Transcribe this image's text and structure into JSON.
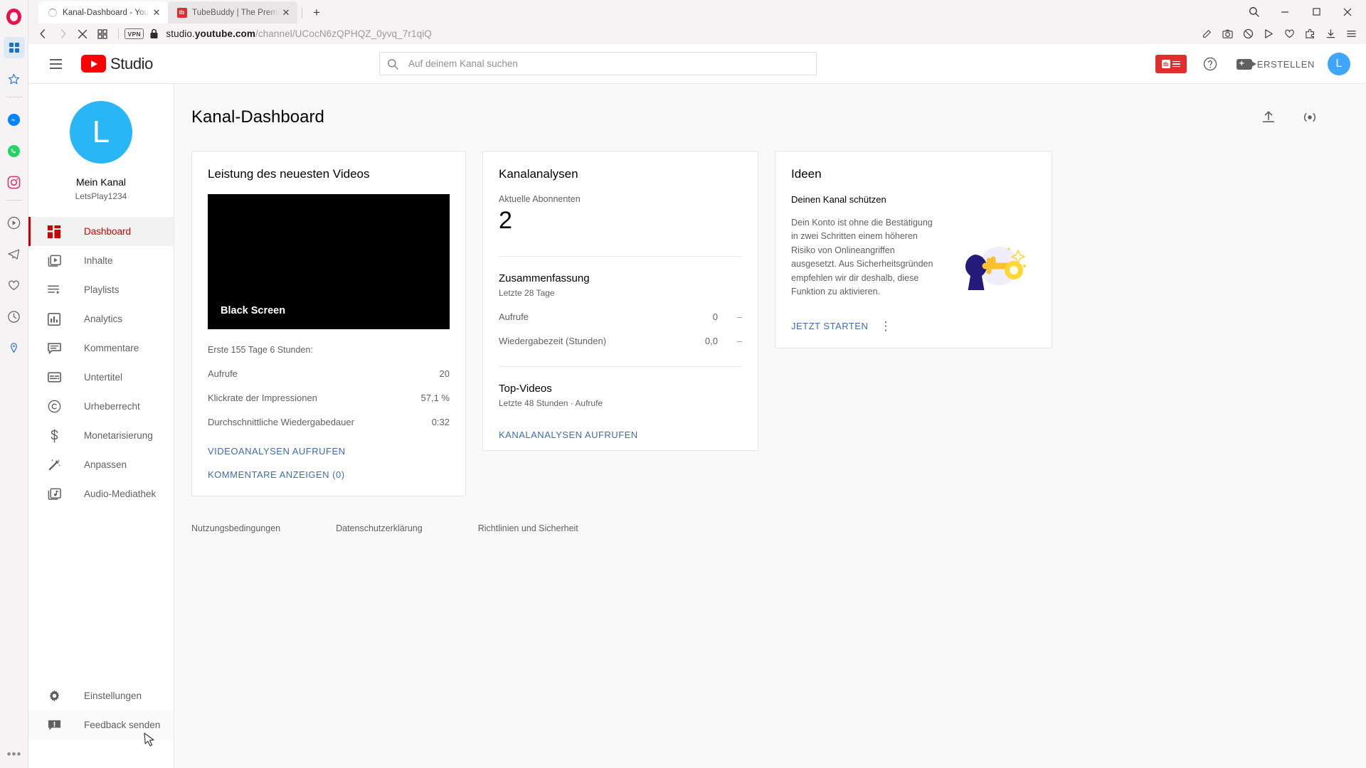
{
  "browser": {
    "tabs": [
      {
        "title": "Kanal-Dashboard - YouTub",
        "favicon": "loading-spinner-icon",
        "active": true
      },
      {
        "title": "TubeBuddy | The Premier",
        "favicon": "tubebuddy-icon",
        "active": false
      }
    ],
    "new_tab_label": "+",
    "close_label": "✕",
    "nav": {
      "back_icon": "back-arrow-icon",
      "forward_icon": "forward-arrow-icon",
      "stop_icon": "stop-icon",
      "tile_icon": "tile-grid-icon",
      "vpn_badge": "VPN",
      "lock_icon": "lock-icon"
    },
    "url": {
      "host_pre": "studio.",
      "host_bold": "youtube.com",
      "path": "/channel/UCocN6zQPHQZ_0yvq_7r1qiQ"
    },
    "window_controls": {
      "minimize": "–",
      "maximize": "□",
      "close": "✕"
    }
  },
  "opera_sidebar": {
    "logo": "opera-logo",
    "items": [
      "opera-workspace-icon",
      "opera-star-icon",
      "messenger-icon",
      "whatsapp-icon",
      "instagram-icon",
      "player-icon",
      "telegram-icon",
      "heart-icon",
      "history-icon",
      "pin-icon"
    ],
    "more_label": "•••"
  },
  "header": {
    "menu_icon": "hamburger-menu-icon",
    "logo_text": "Studio",
    "search": {
      "placeholder": "Auf deinem Kanal suchen",
      "value": "",
      "icon": "search-icon"
    },
    "tubebuddy_label": "tb",
    "help_icon": "help-circle-icon",
    "create_label": "ERSTELLEN",
    "avatar_letter": "L"
  },
  "sidebar": {
    "avatar_letter": "L",
    "channel_name": "Mein Kanal",
    "channel_handle": "LetsPlay1234",
    "items": [
      {
        "label": "Dashboard",
        "icon": "dashboard-icon",
        "active": true
      },
      {
        "label": "Inhalte",
        "icon": "content-icon",
        "active": false
      },
      {
        "label": "Playlists",
        "icon": "playlist-icon",
        "active": false
      },
      {
        "label": "Analytics",
        "icon": "analytics-icon",
        "active": false
      },
      {
        "label": "Kommentare",
        "icon": "comment-icon",
        "active": false
      },
      {
        "label": "Untertitel",
        "icon": "subtitles-icon",
        "active": false
      },
      {
        "label": "Urheberrecht",
        "icon": "copyright-icon",
        "active": false
      },
      {
        "label": "Monetarisierung",
        "icon": "dollar-icon",
        "active": false
      },
      {
        "label": "Anpassen",
        "icon": "magic-wand-icon",
        "active": false
      },
      {
        "label": "Audio-Mediathek",
        "icon": "audio-note-icon",
        "active": false
      }
    ],
    "bottom_items": [
      {
        "label": "Einstellungen",
        "icon": "gear-icon"
      },
      {
        "label": "Feedback senden",
        "icon": "feedback-icon"
      }
    ]
  },
  "main": {
    "page_title": "Kanal-Dashboard",
    "head_actions": [
      {
        "name": "upload-video-button",
        "icon": "upload-icon"
      },
      {
        "name": "go-live-button",
        "icon": "live-broadcast-icon"
      }
    ],
    "card_latest": {
      "title": "Leistung des neuesten Videos",
      "thumbnail_title": "Black Screen",
      "period": "Erste 155 Tage 6 Stunden:",
      "stats": [
        {
          "label": "Aufrufe",
          "value": "20"
        },
        {
          "label": "Klickrate der Impressionen",
          "value": "57,1 %"
        },
        {
          "label": "Durchschnittliche Wiedergabedauer",
          "value": "0:32"
        }
      ],
      "link_analytics": "VIDEOANALYSEN AUFRUFEN",
      "link_comments": "KOMMENTARE ANZEIGEN (0)"
    },
    "card_analytics": {
      "title": "Kanalanalysen",
      "subs_label": "Aktuelle Abonnenten",
      "subs_value": "2",
      "summary_title": "Zusammenfassung",
      "summary_sub": "Letzte 28 Tage",
      "summary_rows": [
        {
          "label": "Aufrufe",
          "value": "0",
          "trend": "–"
        },
        {
          "label": "Wiedergabezeit (Stunden)",
          "value": "0,0",
          "trend": "–"
        }
      ],
      "top_videos_title": "Top-Videos",
      "top_videos_sub": "Letzte 48 Stunden · Aufrufe",
      "link": "KANALANALYSEN AUFRUFEN"
    },
    "card_ideas": {
      "title": "Ideen",
      "headline": "Deinen Kanal schützen",
      "body": "Dein Konto ist ohne die Bestätigung in zwei Schritten einem höheren Risiko von Onlineangriffen ausgesetzt. Aus Sicherheitsgründen empfehlen wir dir deshalb, diese Funktion zu aktivieren.",
      "link": "JETZT STARTEN",
      "more_icon": "more-vertical-icon",
      "art": "keyhole-and-key-illustration"
    },
    "footer": [
      "Nutzungsbedingungen",
      "Datenschutzerklärung",
      "Richtlinien und Sicherheit"
    ]
  },
  "colors": {
    "accent_red": "#c00000",
    "link_blue": "#3f6ca8",
    "avatar_blue": "#29b6f6",
    "opera_red": "#e8114b"
  }
}
